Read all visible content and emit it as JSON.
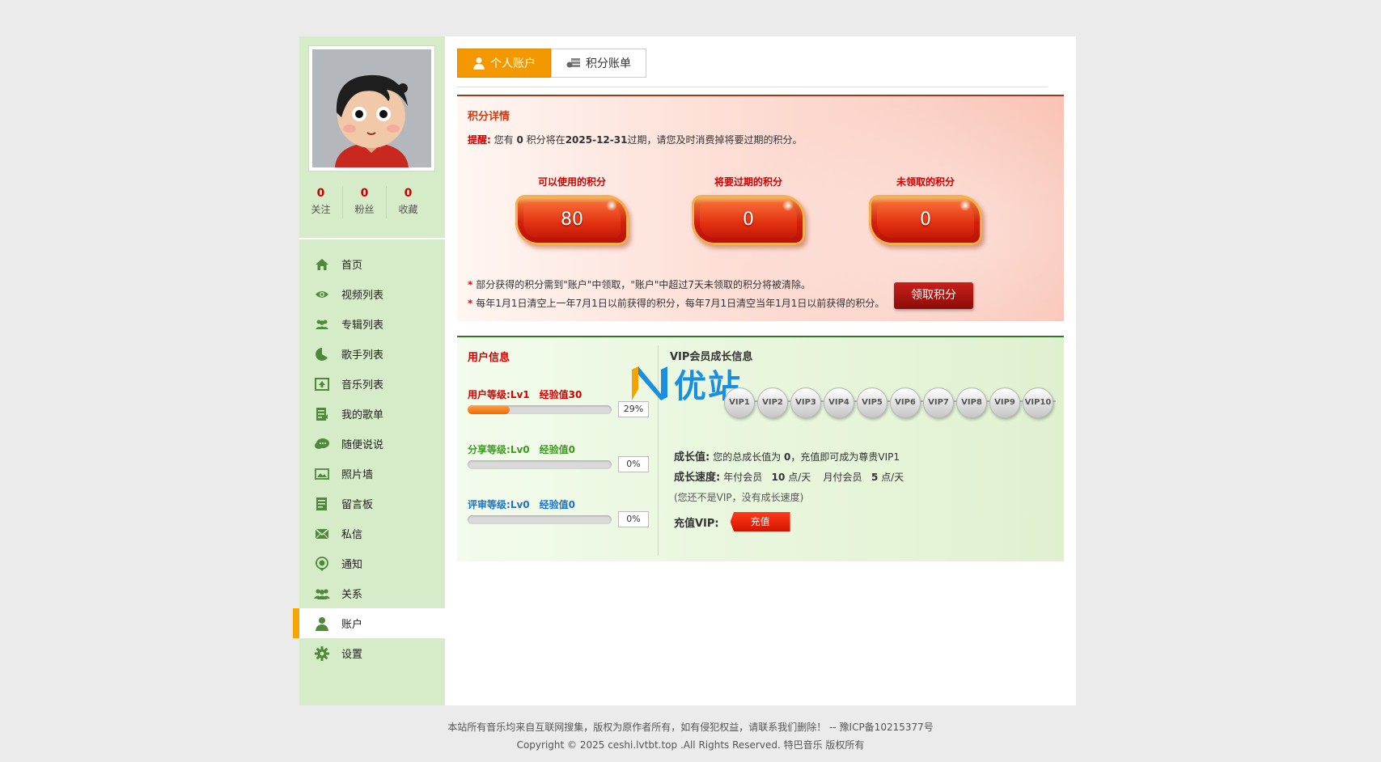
{
  "profile": {
    "stats": [
      {
        "value": "0",
        "label": "关注"
      },
      {
        "value": "0",
        "label": "粉丝"
      },
      {
        "value": "0",
        "label": "收藏"
      }
    ]
  },
  "menu": [
    {
      "label": "首页",
      "icon": "home-icon"
    },
    {
      "label": "视频列表",
      "icon": "eye-icon"
    },
    {
      "label": "专辑列表",
      "icon": "people-icon"
    },
    {
      "label": "歌手列表",
      "icon": "singer-icon"
    },
    {
      "label": "音乐列表",
      "icon": "upload-icon"
    },
    {
      "label": "我的歌单",
      "icon": "playlist-icon"
    },
    {
      "label": "随便说说",
      "icon": "chat-icon"
    },
    {
      "label": "照片墙",
      "icon": "photo-icon"
    },
    {
      "label": "留言板",
      "icon": "note-icon"
    },
    {
      "label": "私信",
      "icon": "mail-icon"
    },
    {
      "label": "通知",
      "icon": "bell-icon"
    },
    {
      "label": "关系",
      "icon": "group-icon"
    },
    {
      "label": "账户",
      "icon": "user-icon",
      "active": true
    },
    {
      "label": "设置",
      "icon": "gear-icon"
    }
  ],
  "tabs": {
    "personal": "个人账户",
    "points_bill": "积分账单"
  },
  "points": {
    "title": "积分详情",
    "remind_label": "提醒:",
    "remind_pre": "您有",
    "remind_count": "0",
    "remind_mid": "积分将在",
    "remind_date": "2025-12-31",
    "remind_post": "过期，请您及时消费掉将要过期的积分。",
    "boxes": [
      {
        "label": "可以使用的积分",
        "value": "80"
      },
      {
        "label": "将要过期的积分",
        "value": "0"
      },
      {
        "label": "未领取的积分",
        "value": "0"
      }
    ],
    "notes": [
      "部分获得的积分需到\"账户\"中领取，\"账户\"中超过7天未领取的积分将被清除。",
      "每年1月1日清空上一年7月1日以前获得的积分，每年7月1日清空当年1月1日以前获得的积分。"
    ],
    "claim_button": "领取积分"
  },
  "user_info": {
    "title": "用户信息",
    "levels": [
      {
        "name": "用户等级:",
        "level": "Lv1",
        "exp_label": "经验值",
        "exp": "30",
        "percent": 29,
        "percent_text": "29%",
        "color": "#d40000"
      },
      {
        "name": "分享等级:",
        "level": "Lv0",
        "exp_label": "经验值",
        "exp": "0",
        "percent": 0,
        "percent_text": "0%",
        "color": "#3b9a1f"
      },
      {
        "name": "评审等级:",
        "level": "Lv0",
        "exp_label": "经验值",
        "exp": "0",
        "percent": 0,
        "percent_text": "0%",
        "color": "#1a72c8"
      }
    ]
  },
  "vip": {
    "title": "VIP会员成长信息",
    "logo_text": "优站",
    "nodes": [
      "VIP1",
      "VIP2",
      "VIP3",
      "VIP4",
      "VIP5",
      "VIP6",
      "VIP7",
      "VIP8",
      "VIP9",
      "VIP10"
    ],
    "growth_label": "成长值:",
    "growth_pre": "您的总成长值为",
    "growth_value": "0",
    "growth_post": "，充值即可成为尊贵VIP1",
    "speed_label": "成长速度:",
    "speed_year_label": "年付会员",
    "speed_year": "10",
    "speed_unit": "点/天",
    "speed_month_label": "月付会员",
    "speed_month": "5",
    "speed_note": "(您还不是VIP，没有成长速度)",
    "charge_label": "充值VIP:",
    "charge_button": "充值"
  },
  "footer": {
    "line1": "本站所有音乐均来自互联网搜集，版权为原作者所有，如有侵犯权益，请联系我们删除！ -- 豫ICP备10215377号",
    "line2": "Copyright © 2025 ceshi.lvtbt.top .All Rights Reserved. 特巴音乐 版权所有"
  },
  "colors": {
    "accent": "#f39800",
    "sidebar_bg": "#d6ecc8",
    "points_border": "#a4361a",
    "user_border": "#2f7a1e"
  }
}
